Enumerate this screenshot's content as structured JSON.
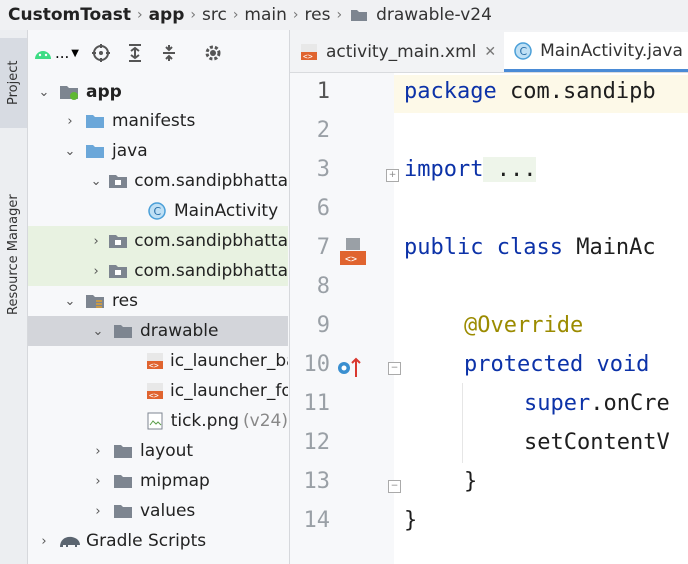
{
  "breadcrumb": {
    "project": "CustomToast",
    "module": "app",
    "src": "src",
    "main": "main",
    "res": "res",
    "folder": "drawable-v24"
  },
  "sidebar_tabs": {
    "project": "Project",
    "resource_manager": "Resource Manager"
  },
  "toolbar": {
    "dropdown_label": "..."
  },
  "tree": {
    "app": "app",
    "manifests": "manifests",
    "java": "java",
    "pkg1": "com.sandipbhatta",
    "main_activity": "MainActivity",
    "pkg2": "com.sandipbhatta",
    "pkg3": "com.sandipbhatta",
    "res": "res",
    "drawable": "drawable",
    "ic_bg": "ic_launcher_ba",
    "ic_fg": "ic_launcher_for",
    "tick": "tick.png",
    "tick_qual": "(v24)",
    "layout": "layout",
    "mipmap": "mipmap",
    "values": "values",
    "gradle": "Gradle Scripts"
  },
  "tabs": {
    "tab1": "activity_main.xml",
    "tab2": "MainActivity.java"
  },
  "editor": {
    "line_numbers": [
      "1",
      "2",
      "3",
      "6",
      "7",
      "8",
      "9",
      "10",
      "11",
      "12",
      "13",
      "14"
    ],
    "l1_kw": "package",
    "l1_rest": " com.sandipb",
    "l3_kw": "import",
    "l3_rest": " ...",
    "l7_kw": "public class",
    "l7_rest": " MainAc",
    "l9": "@Override",
    "l10": "protected void",
    "l11_a": "super",
    "l11_b": ".onCre",
    "l12": "setContentV",
    "l13": "}",
    "l14": "}"
  },
  "colors": {
    "keyword": "#0c32a8",
    "annotation": "#9b8b00",
    "active_tab": "#4a8bd6"
  }
}
